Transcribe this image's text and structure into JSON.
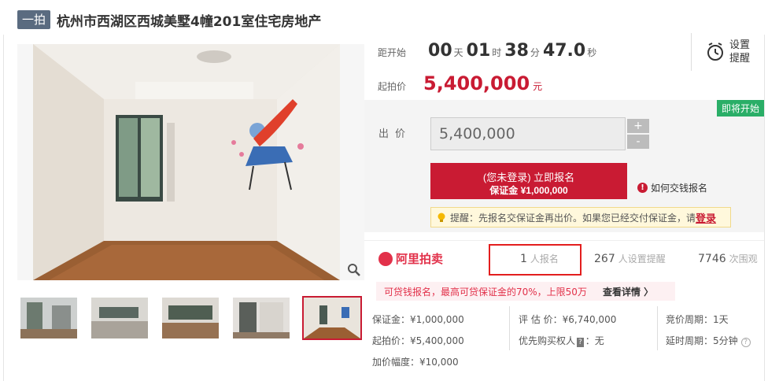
{
  "title": {
    "tag": "一拍",
    "text": "杭州市西湖区西城美墅4幢201室住宅房地产"
  },
  "countdown": {
    "label": "距开始",
    "days": "00",
    "days_unit": "天",
    "hours": "01",
    "hours_unit": "时",
    "minutes": "38",
    "minutes_unit": "分",
    "seconds": "47.0",
    "seconds_unit": "秒"
  },
  "start_price": {
    "label": "起拍价",
    "value": "5,400,000",
    "unit": "元"
  },
  "remind": {
    "line1": "设置",
    "line2": "提醒"
  },
  "bid": {
    "status_tag": "即将开始",
    "label": "出价",
    "input_value": "5,400,000",
    "plus": "+",
    "minus": "-",
    "signup_main": "(您未登录) 立即报名",
    "signup_sub": "保证金 ¥1,000,000",
    "how_pay": "如何交钱报名",
    "tip_prefix": "提醒：先报名交保证金再出价。如果您已经交付保证金，请",
    "tip_login": "登录"
  },
  "stats": {
    "logo_text": "阿里拍卖",
    "signups_num": "1",
    "signups_label": "人报名",
    "reminders_num": "267",
    "reminders_label": "人设置提醒",
    "views_num": "7746",
    "views_label": "次围观"
  },
  "loan": {
    "text": "可贷钱报名，最高可贷保证金的70%，上限50万",
    "link": "查看详情 〉"
  },
  "details": {
    "deposit": "保证金：¥1,000,000",
    "start": "起拍价：¥5,400,000",
    "increment": "加价幅度：¥10,000",
    "appraisal": "评 估 价：¥6,740,000",
    "priority_prefix": "优先购买权人",
    "priority_badge": "?",
    "priority_suffix": "：无",
    "cycle": "竞价周期：1天",
    "delay": "延时周期：5分钟"
  },
  "colors": {
    "accent": "#c91b33",
    "status_green": "#2aae67",
    "title_tag": "#5a6b80"
  }
}
